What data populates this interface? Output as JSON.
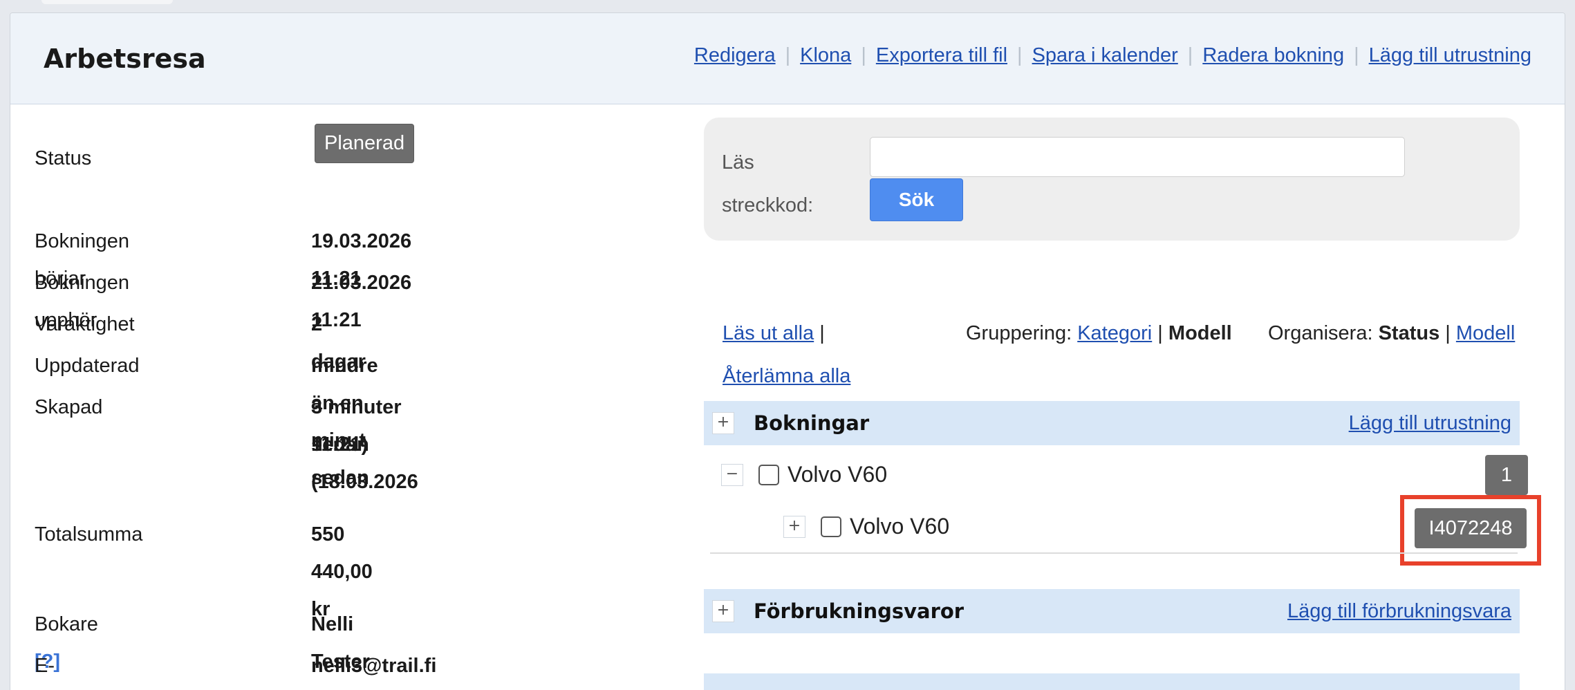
{
  "header": {
    "title": "Arbetsresa",
    "actions": [
      "Redigera",
      "Klona",
      "Exportera till fil",
      "Spara i kalender",
      "Radera bokning",
      "Lägg till utrustning"
    ]
  },
  "info": {
    "status_label": "Status",
    "status_value": "Planerad",
    "starts_label": "Bokningen börjar",
    "starts_value": "19.03.2026 11:21",
    "ends_label": "Bokningen upphör",
    "ends_value": "21.03.2026 11:21",
    "duration_label": "Varaktighet",
    "duration_value": "2 dagar",
    "updated_label": "Uppdaterad",
    "updated_value": "mindre än en minut sedan",
    "created_label": "Skapad",
    "created_value_line1": "3 minuter sedan (18.03.2026",
    "created_value_line2": "11:21)",
    "total_label": "Totalsumma",
    "total_value": "550 440,00 kr",
    "booker_label": "Bokare",
    "booker_help": "[?]",
    "booker_value": "Nelli Tester",
    "email_label": "E-post",
    "email_value": "nelli3@trail.fi"
  },
  "barcode": {
    "label_line1": "Läs",
    "label_line2": "streckkod:",
    "input_value": "",
    "search_button": "Sök"
  },
  "toolbar": {
    "checkout_all": "Läs ut alla",
    "return_all": "Återlämna alla",
    "pipe": "|",
    "grouping_label": "Gruppering:",
    "grouping_category": "Kategori",
    "grouping_model": "Modell",
    "organize_label": "Organisera:",
    "organize_status": "Status",
    "organize_model": "Modell"
  },
  "sections": {
    "bookings": {
      "title": "Bokningar",
      "action": "Lägg till utrustning",
      "expander": "+",
      "group": {
        "expander": "−",
        "name": "Volvo V60",
        "count": "1",
        "item": {
          "expander": "+",
          "name": "Volvo V60",
          "code": "I4072248"
        }
      }
    },
    "consumables": {
      "title": "Förbrukningsvaror",
      "action": "Lägg till förbrukningsvara",
      "expander": "+"
    }
  },
  "colors": {
    "header_bg": "#eef3f9",
    "section_bg": "#d8e7f7",
    "link": "#1f4fb0",
    "button": "#4f8df0",
    "badge": "#6d6d6d",
    "highlight": "#e8412b"
  }
}
